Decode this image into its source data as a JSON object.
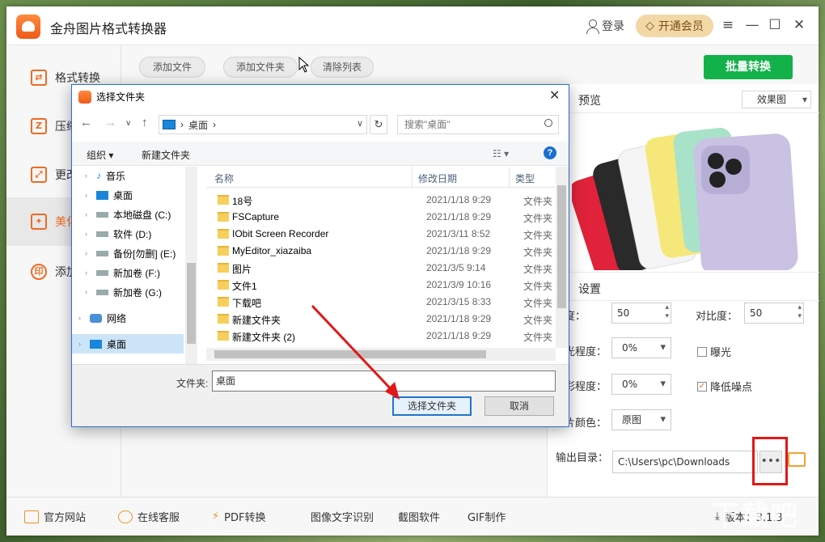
{
  "app": {
    "title": "金舟图片格式转换器",
    "login": "登录",
    "vip": "开通会员",
    "window_controls": [
      "menu-icon",
      "minimize-icon",
      "maximize-icon",
      "close-icon"
    ]
  },
  "sidebar": {
    "items": [
      {
        "label": "格式转换",
        "icon": "convert-icon"
      },
      {
        "label": "压缩",
        "icon": "compress-icon"
      },
      {
        "label": "更改",
        "icon": "resize-icon"
      },
      {
        "label": "美化",
        "icon": "beautify-icon",
        "active": true
      },
      {
        "label": "添加",
        "icon": "watermark-icon"
      }
    ]
  },
  "toolbar": {
    "add_file": "添加文件",
    "add_folder": "添加文件夹",
    "clear_list": "清除列表",
    "batch_convert": "批量转换"
  },
  "preview": {
    "label": "预览",
    "effect_select": "效果图"
  },
  "settings": {
    "label": "设置",
    "brightness_label": "度：",
    "brightness_value": "50",
    "contrast_label": "对比度：",
    "contrast_value": "50",
    "exposure_degree_label": "光程度：",
    "exposure_degree_value": "0%",
    "exposure_label": "曝光",
    "saturation_label": "彩程度：",
    "saturation_value": "0%",
    "denoise_label": "降低噪点",
    "color_label": "片颜色：",
    "color_value": "原图",
    "output_label": "输出目录：",
    "output_value": "C:\\Users\\pc\\Downloads",
    "dots": "•••"
  },
  "footer": {
    "items": [
      "官方网站",
      "在线客服",
      "PDF转换",
      "图像文字识别",
      "截图软件",
      "GIF制作"
    ],
    "version": "版本：3.1.3"
  },
  "dialog": {
    "title": "选择文件夹",
    "address": "桌面",
    "search_placeholder": "搜索\"桌面\"",
    "organize": "组织 ▾",
    "new_folder": "新建文件夹",
    "tree": [
      {
        "label": "音乐",
        "icon": "music-icon"
      },
      {
        "label": "桌面",
        "icon": "desktop-icon"
      },
      {
        "label": "本地磁盘 (C:)",
        "icon": "drive-icon"
      },
      {
        "label": "软件 (D:)",
        "icon": "drive-icon"
      },
      {
        "label": "备份[勿删] (E:)",
        "icon": "drive-icon"
      },
      {
        "label": "新加卷 (F:)",
        "icon": "drive-icon"
      },
      {
        "label": "新加卷 (G:)",
        "icon": "drive-icon"
      },
      {
        "label": "网络",
        "icon": "network-icon"
      },
      {
        "label": "桌面",
        "icon": "desktop-icon",
        "selected": true
      }
    ],
    "columns": [
      "名称",
      "修改日期",
      "类型"
    ],
    "rows": [
      {
        "name": "18号",
        "date": "2021/1/18 9:29",
        "type": "文件夹"
      },
      {
        "name": "FSCapture",
        "date": "2021/1/18 9:29",
        "type": "文件夹"
      },
      {
        "name": "IObit Screen Recorder",
        "date": "2021/3/11 8:52",
        "type": "文件夹"
      },
      {
        "name": "MyEditor_xiazaiba",
        "date": "2021/1/18 9:29",
        "type": "文件夹"
      },
      {
        "name": "图片",
        "date": "2021/3/5 9:14",
        "type": "文件夹"
      },
      {
        "name": "文件1",
        "date": "2021/3/9 10:16",
        "type": "文件夹"
      },
      {
        "name": "下载吧",
        "date": "2021/3/15 8:33",
        "type": "文件夹"
      },
      {
        "name": "新建文件夹",
        "date": "2021/1/18 9:29",
        "type": "文件夹"
      },
      {
        "name": "新建文件夹 (2)",
        "date": "2021/1/18 9:29",
        "type": "文件夹"
      }
    ],
    "folder_label": "文件夹:",
    "folder_value": "桌面",
    "select_button": "选择文件夹",
    "cancel_button": "取消"
  }
}
